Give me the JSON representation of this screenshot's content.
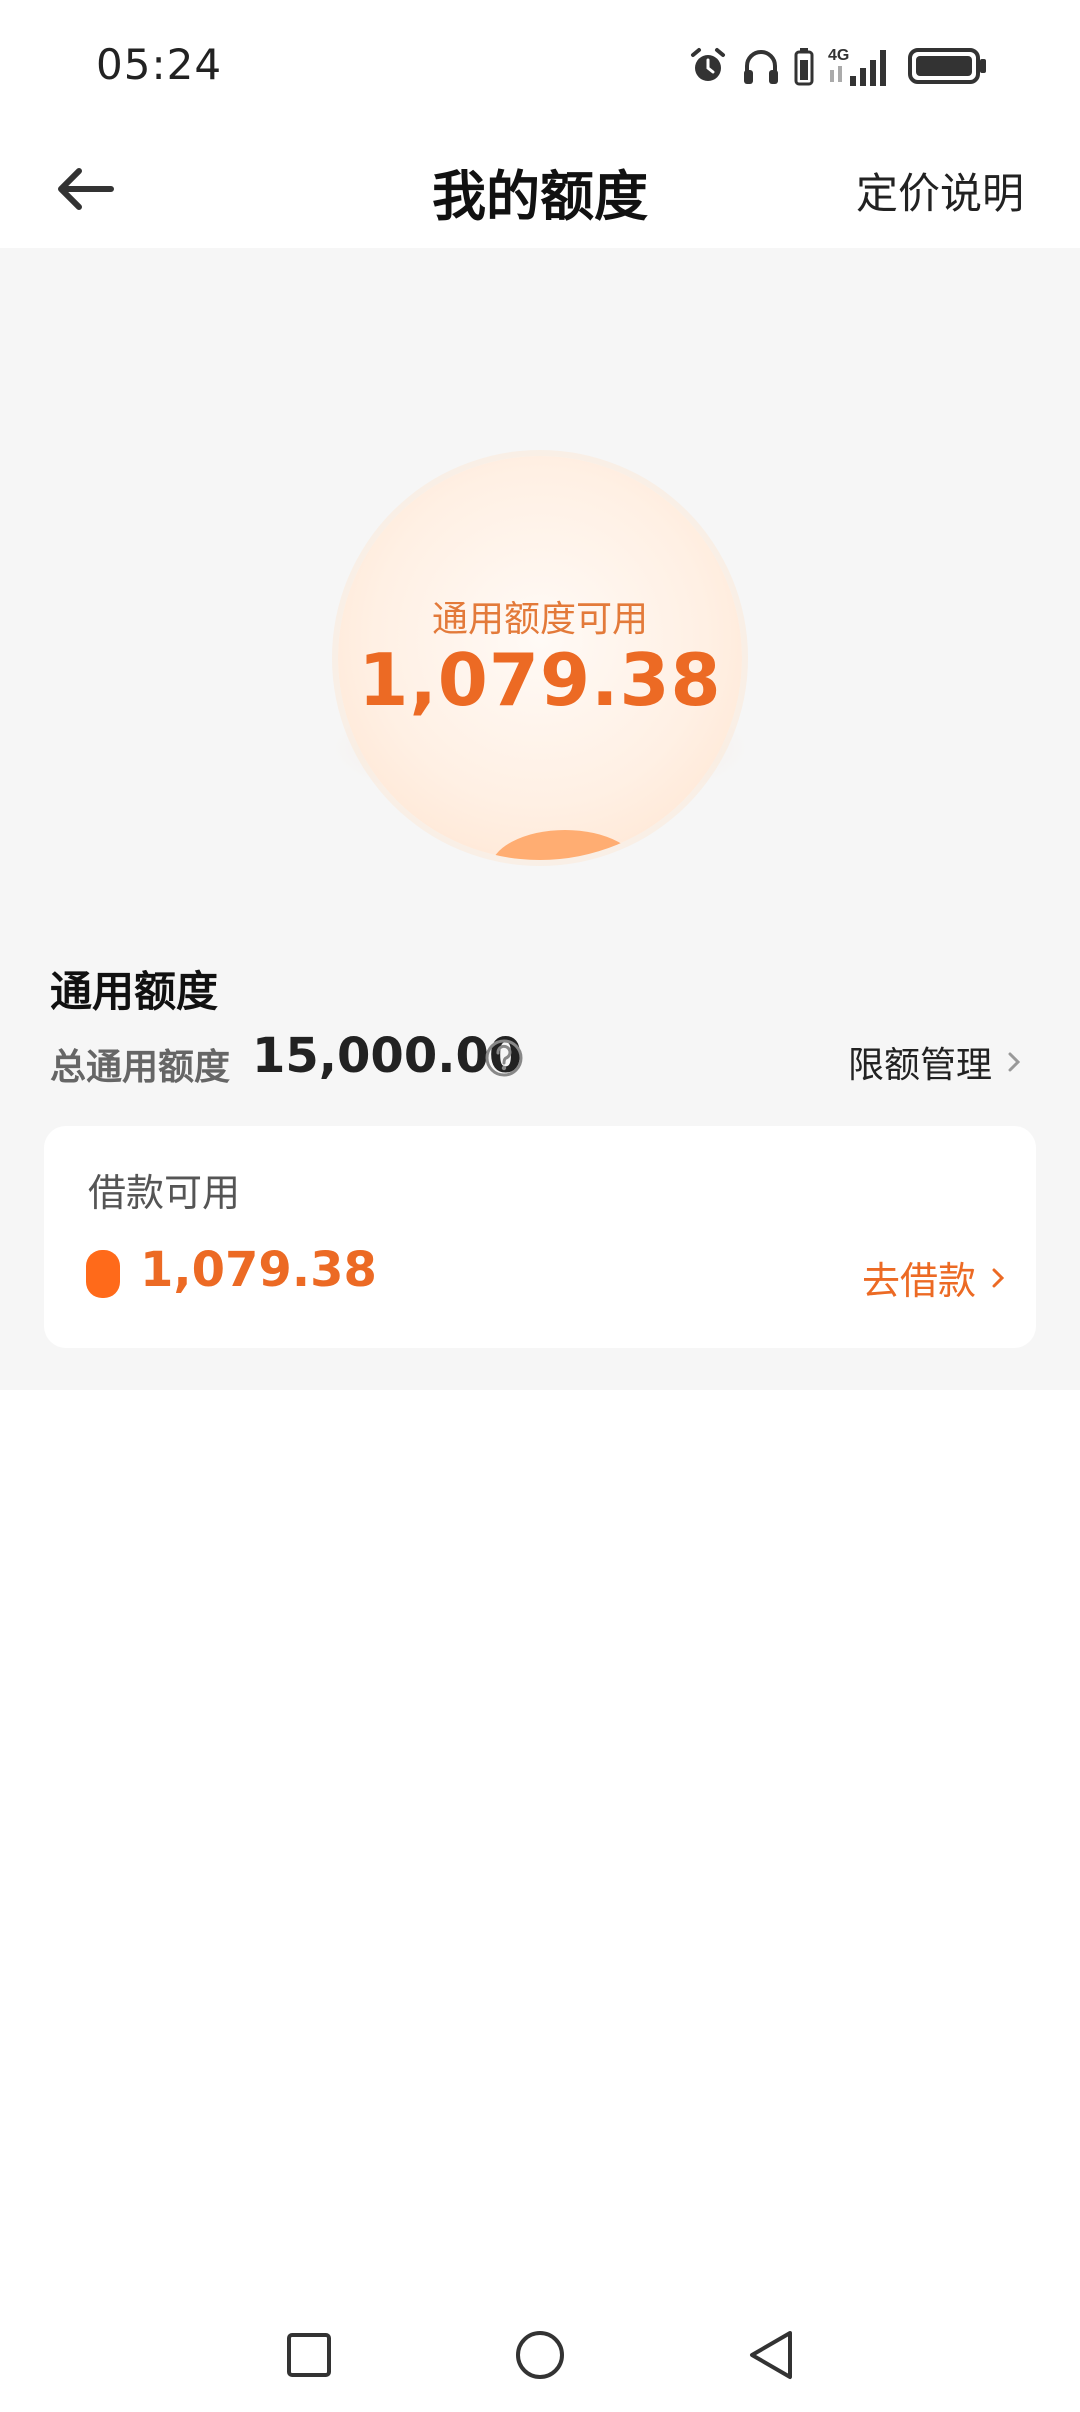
{
  "status_bar": {
    "time": "05:24",
    "icons": [
      "alarm-icon",
      "headphones-icon",
      "battery-small-icon",
      "signal-4g-icon",
      "battery-icon"
    ],
    "network_label": "4G"
  },
  "nav": {
    "title": "我的额度",
    "right_link": "定价说明",
    "back_icon": "arrow-left-icon"
  },
  "summary": {
    "label": "通用额度可用",
    "amount": "1,079.38",
    "accent_color": "#ec6a24"
  },
  "general_quota": {
    "section_title": "通用额度",
    "total_label": "总通用额度",
    "total_amount": "15,000.00",
    "help_icon": "question-circle-icon",
    "limit_link": "限额管理"
  },
  "loan_card": {
    "label": "借款可用",
    "amount": "1,079.38",
    "action": "去借款"
  },
  "system_nav": {
    "buttons": [
      "recent-apps-icon",
      "home-icon",
      "back-icon"
    ]
  }
}
